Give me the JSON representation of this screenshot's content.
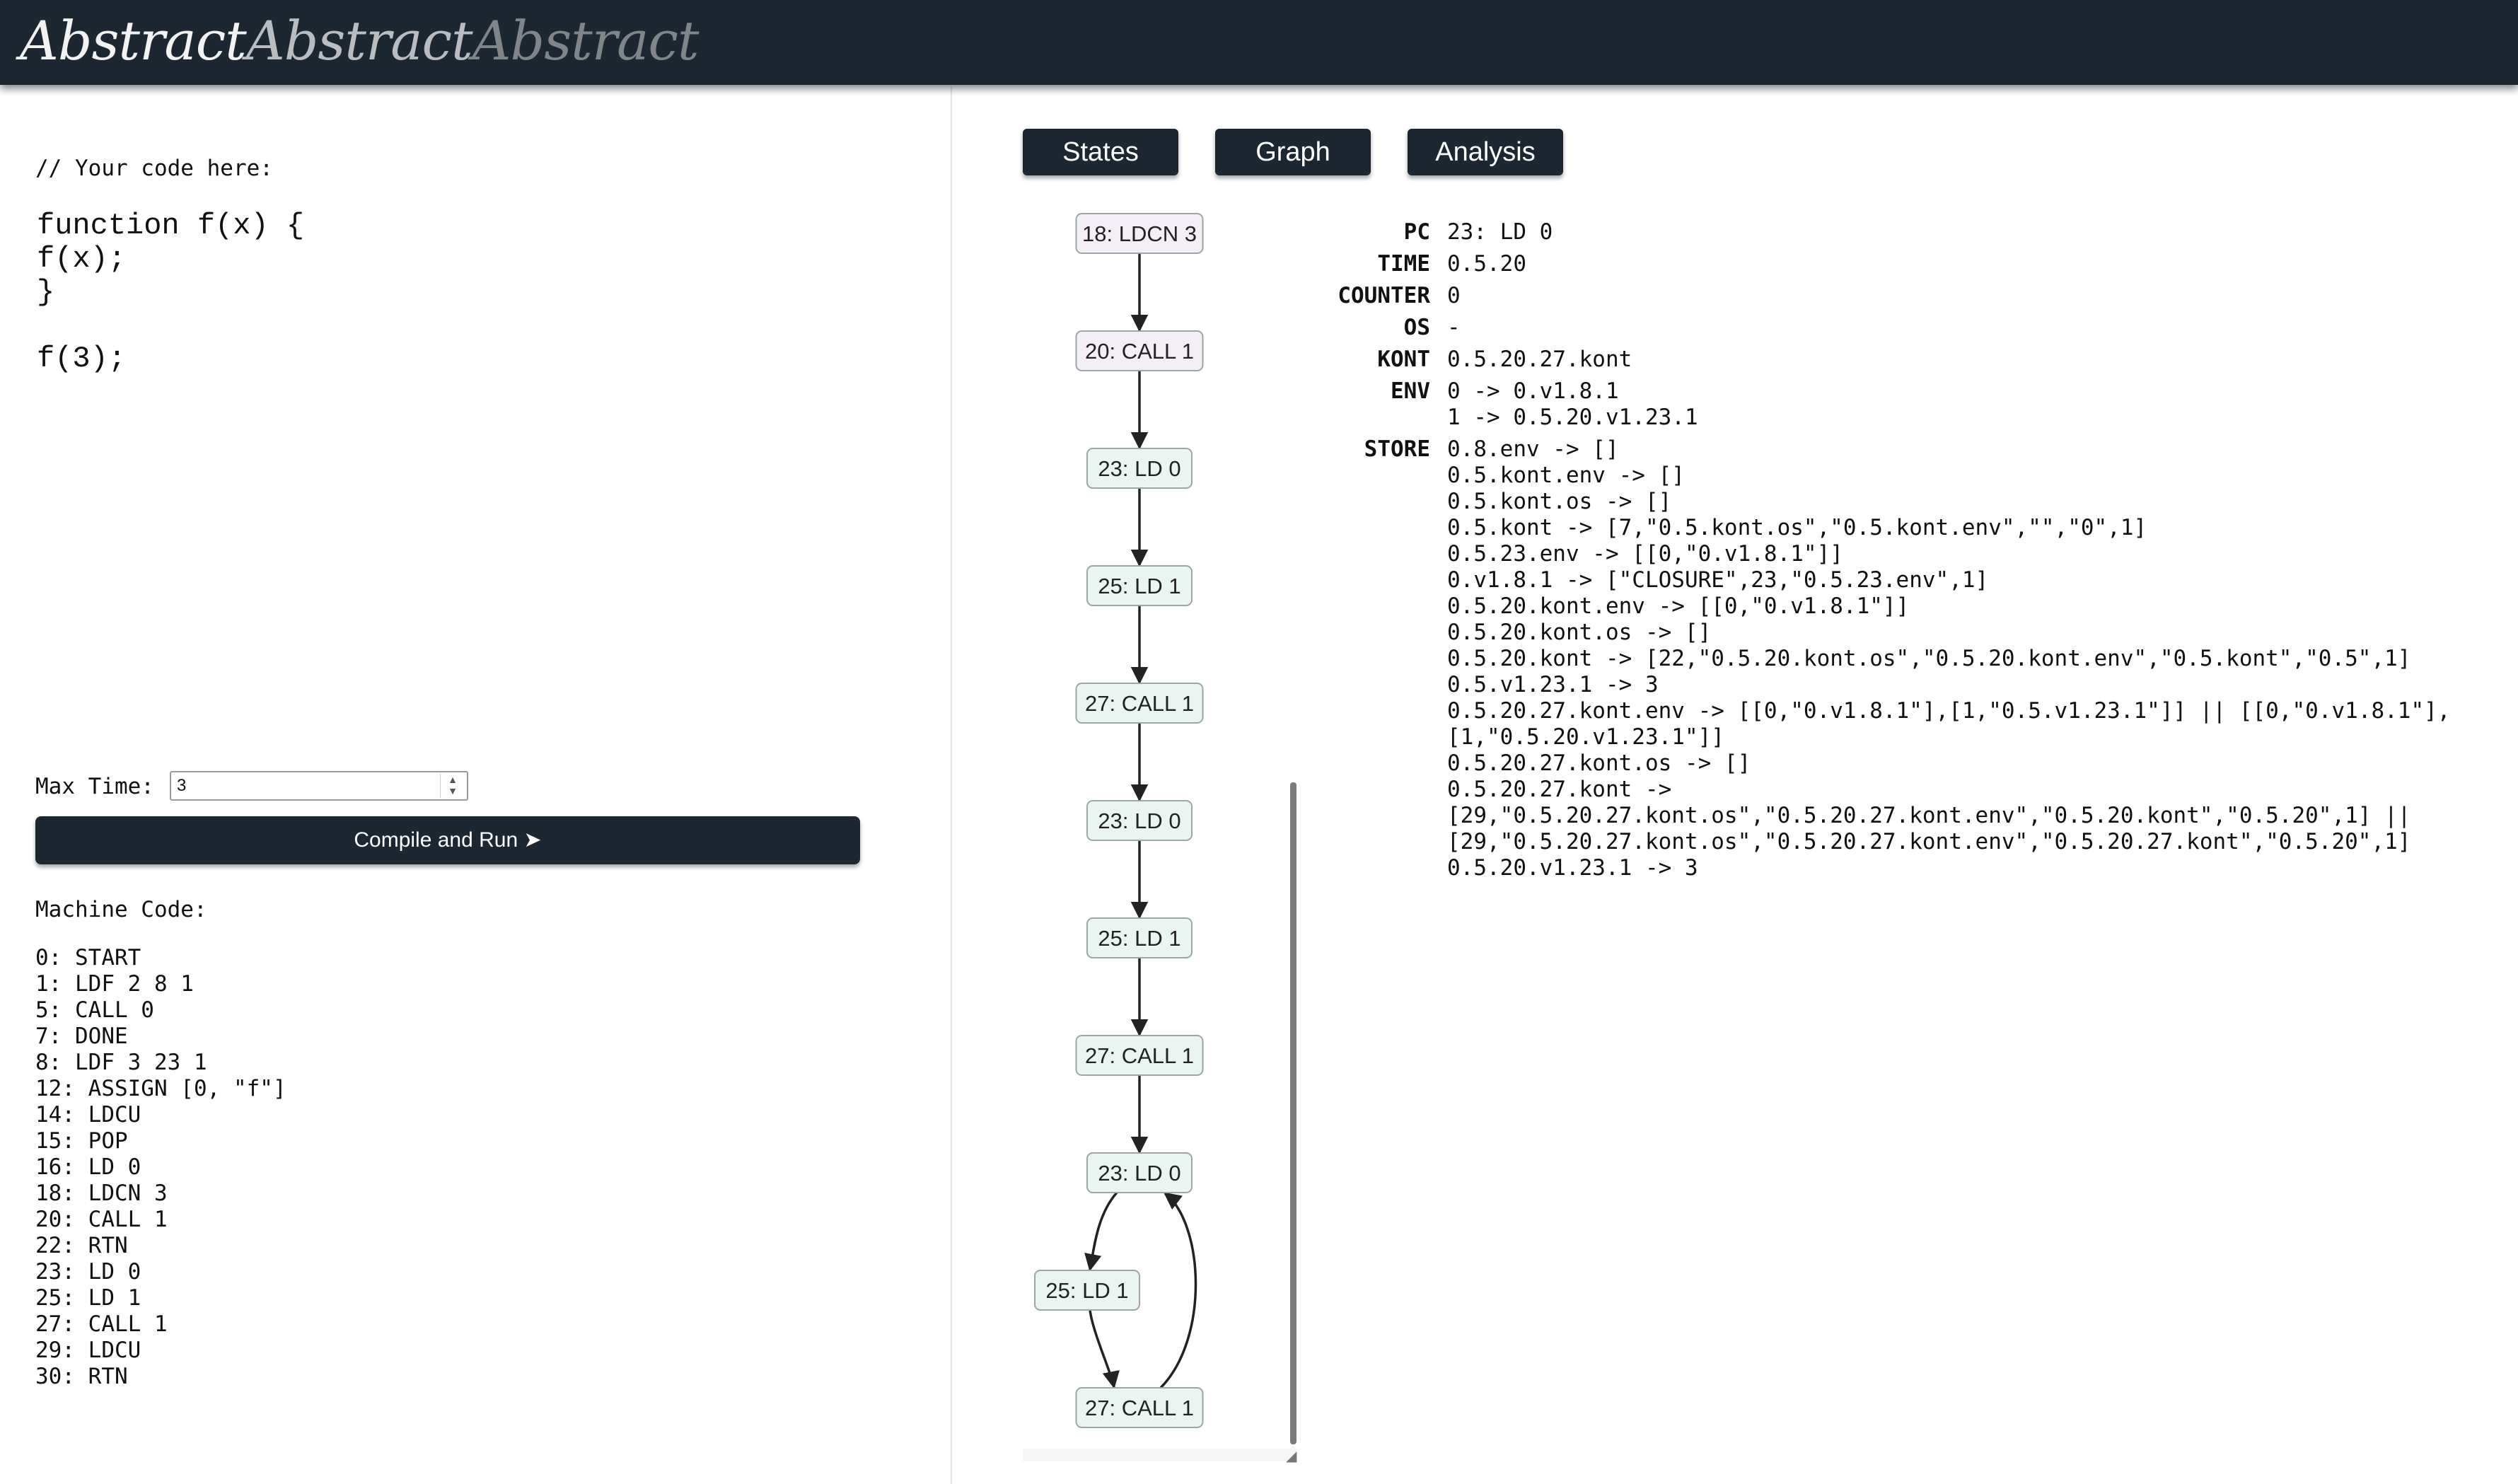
{
  "header": {
    "logo": [
      "Abstract",
      "Abstract",
      "Abstract"
    ]
  },
  "editor": {
    "comment": "// Your code here:",
    "code": "function f(x) {\nf(x);\n}\n\nf(3);"
  },
  "controls": {
    "max_time_label": "Max Time:",
    "max_time_value": "3",
    "run_label": "Compile and Run ➤"
  },
  "machine_code": {
    "label": "Machine Code:",
    "lines": [
      "0: START",
      "1: LDF 2 8 1",
      "5: CALL 0",
      "7: DONE",
      "8: LDF 3 23 1",
      "12: ASSIGN [0, \"f\"]",
      "14: LDCU",
      "15: POP",
      "16: LD 0",
      "18: LDCN 3",
      "20: CALL 1",
      "22: RTN",
      "23: LD 0",
      "25: LD 1",
      "27: CALL 1",
      "29: LDCU",
      "30: RTN"
    ]
  },
  "tabs": [
    "States",
    "Graph",
    "Analysis"
  ],
  "graph": {
    "colors": {
      "node_purple": "#f4eef6",
      "node_green": "#eaf4f0",
      "stroke": "#9ca6a2",
      "edge": "#222222"
    },
    "nodes": [
      {
        "label": "18: LDCN 3",
        "style": "purple"
      },
      {
        "label": "20: CALL 1",
        "style": "purple"
      },
      {
        "label": "23: LD 0",
        "style": "green"
      },
      {
        "label": "25: LD 1",
        "style": "green"
      },
      {
        "label": "27: CALL 1",
        "style": "green"
      },
      {
        "label": "23: LD 0",
        "style": "green"
      },
      {
        "label": "25: LD 1",
        "style": "green"
      },
      {
        "label": "27: CALL 1",
        "style": "green"
      },
      {
        "label": "23: LD 0",
        "style": "green"
      },
      {
        "label": "25: LD 1",
        "style": "green"
      },
      {
        "label": "27: CALL 1",
        "style": "green"
      }
    ]
  },
  "state": {
    "rows": [
      {
        "key": "PC",
        "lines": [
          "23: LD 0"
        ]
      },
      {
        "key": "TIME",
        "lines": [
          "0.5.20"
        ]
      },
      {
        "key": "COUNTER",
        "lines": [
          "0"
        ]
      },
      {
        "key": "OS",
        "lines": [
          "-"
        ]
      },
      {
        "key": "KONT",
        "lines": [
          "0.5.20.27.kont"
        ]
      },
      {
        "key": "ENV",
        "lines": [
          "0 -> 0.v1.8.1",
          "1 -> 0.5.20.v1.23.1"
        ]
      },
      {
        "key": "STORE",
        "lines": [
          "0.8.env -> []",
          "0.5.kont.env -> []",
          "0.5.kont.os -> []",
          "0.5.kont -> [7,\"0.5.kont.os\",\"0.5.kont.env\",\"\",\"0\",1]",
          "0.5.23.env -> [[0,\"0.v1.8.1\"]]",
          "0.v1.8.1 -> [\"CLOSURE\",23,\"0.5.23.env\",1]",
          "0.5.20.kont.env -> [[0,\"0.v1.8.1\"]]",
          "0.5.20.kont.os -> []",
          "0.5.20.kont -> [22,\"0.5.20.kont.os\",\"0.5.20.kont.env\",\"0.5.kont\",\"0.5\",1]",
          "0.5.v1.23.1 -> 3",
          "0.5.20.27.kont.env -> [[0,\"0.v1.8.1\"],[1,\"0.5.v1.23.1\"]] || [[0,\"0.v1.8.1\"],",
          "[1,\"0.5.20.v1.23.1\"]]",
          "0.5.20.27.kont.os -> []",
          "0.5.20.27.kont ->",
          "[29,\"0.5.20.27.kont.os\",\"0.5.20.27.kont.env\",\"0.5.20.kont\",\"0.5.20\",1] ||",
          "[29,\"0.5.20.27.kont.os\",\"0.5.20.27.kont.env\",\"0.5.20.27.kont\",\"0.5.20\",1]",
          "0.5.20.v1.23.1 -> 3"
        ]
      }
    ]
  }
}
